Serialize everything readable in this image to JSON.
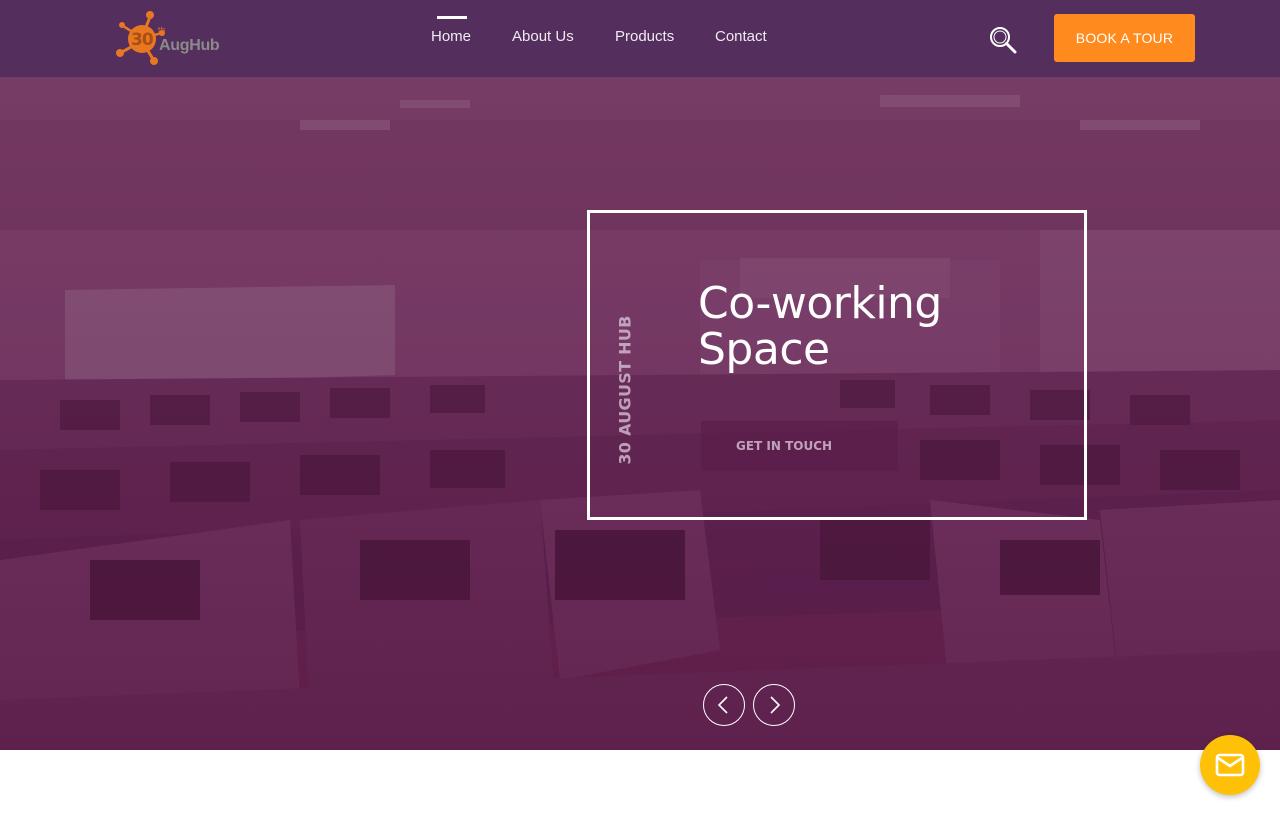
{
  "header": {
    "logo": {
      "number": "30",
      "superscript": "th",
      "wordmark": "AugHub"
    },
    "nav": [
      {
        "label": "Home",
        "active": true
      },
      {
        "label": "About Us",
        "active": false
      },
      {
        "label": "Products",
        "active": false
      },
      {
        "label": "Contact",
        "active": false
      }
    ],
    "search_icon": "search-icon",
    "cta_label": "BOOK A TOUR"
  },
  "slide": {
    "vertical_tag": "30 AUGUST HUB",
    "title_line1": "Co-working",
    "title_line2": "Space",
    "button_label": "GET IN TOUCH"
  },
  "slider": {
    "prev_icon": "chevron-left-icon",
    "next_icon": "chevron-right-icon"
  },
  "fab": {
    "icon": "mail-icon"
  },
  "colors": {
    "accent_orange": "#ff8a1d",
    "fab_yellow": "#ffc107",
    "overlay_purple": "#6c2d55",
    "header_purple": "#4e2d5c"
  }
}
